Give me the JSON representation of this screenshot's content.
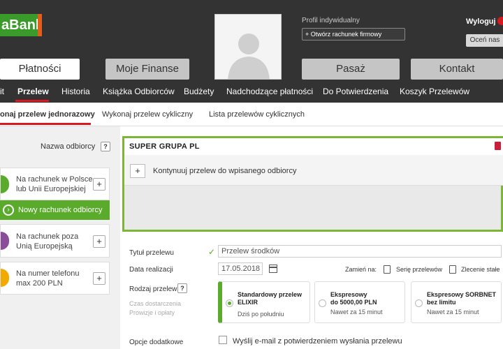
{
  "header": {
    "logo_text": "aBank",
    "profile_label": "Profil indywidualny",
    "open_account_button": "Otwórz rachunek firmowy",
    "logout_label": "Wyloguj",
    "rate_button": "Oceń nas",
    "nav": [
      "Płatności",
      "Moje Finanse",
      "Pasaż",
      "Kontakt"
    ]
  },
  "subnav": {
    "items": [
      "it",
      "Przelew",
      "Historia",
      "Książka Odbiorców",
      "Budżety",
      "Nadchodzące płatności",
      "Do Potwierdzenia",
      "Koszyk Przelewów"
    ]
  },
  "tabs": [
    "onaj przelew jednorazowy",
    "Wykonaj przelew cykliczny",
    "Lista przelewów cyklicznych"
  ],
  "left_panel": {
    "recipient_label": "Nazwa odbiorcy",
    "help": "?",
    "cards": [
      {
        "line1": "Na rachunek w Polsce",
        "line2": "lub Unii Europejskiej"
      },
      {
        "line1": "Na rachunek poza",
        "line2": "Unią Europejską"
      },
      {
        "line1": "Na numer telefonu",
        "line2": "max 200 PLN"
      }
    ],
    "new_recipient_button": "Nowy rachunek odbiorcy",
    "plus": "+"
  },
  "form": {
    "recipient_value": "SUPER GRUPA PL",
    "suggestion_text": "Kontynuuj przelew do wpisanego odbiorcy",
    "title_label": "Tytuł przelewu",
    "title_placeholder": "Przelew środków",
    "date_label": "Data realizacji",
    "date_value": "17.05.2018",
    "swap_label": "Zamień na:",
    "series_label": "Serię przelewów",
    "standing_order_label": "Zlecenie stałe",
    "type_label": "Rodzaj przelewu",
    "delivery_label": "Czas dostarczenia",
    "fees_label": "Prowizje i opłaty",
    "transfer_types": [
      {
        "name1": "Standardowy przelew",
        "name2": "ELIXIR",
        "when": "Dziś po południu",
        "selected": true
      },
      {
        "name1": "Ekspresowy",
        "name2": "do 5000,00 PLN",
        "when": "Nawet za 15 minut",
        "selected": false
      },
      {
        "name1": "Ekspresowy SORBNET",
        "name2": "bez limitu",
        "when": "Nawet za 15 minut",
        "selected": false
      }
    ],
    "options_label": "Opcje dodatkowe",
    "email_option": "Wyślij e-mail z potwierdzeniem wysłania przelewu"
  },
  "colors": {
    "accent_green": "#5aab2c",
    "accent_red": "#d71920",
    "header_bg": "#333333",
    "dropdown_border": "#7bb634"
  }
}
